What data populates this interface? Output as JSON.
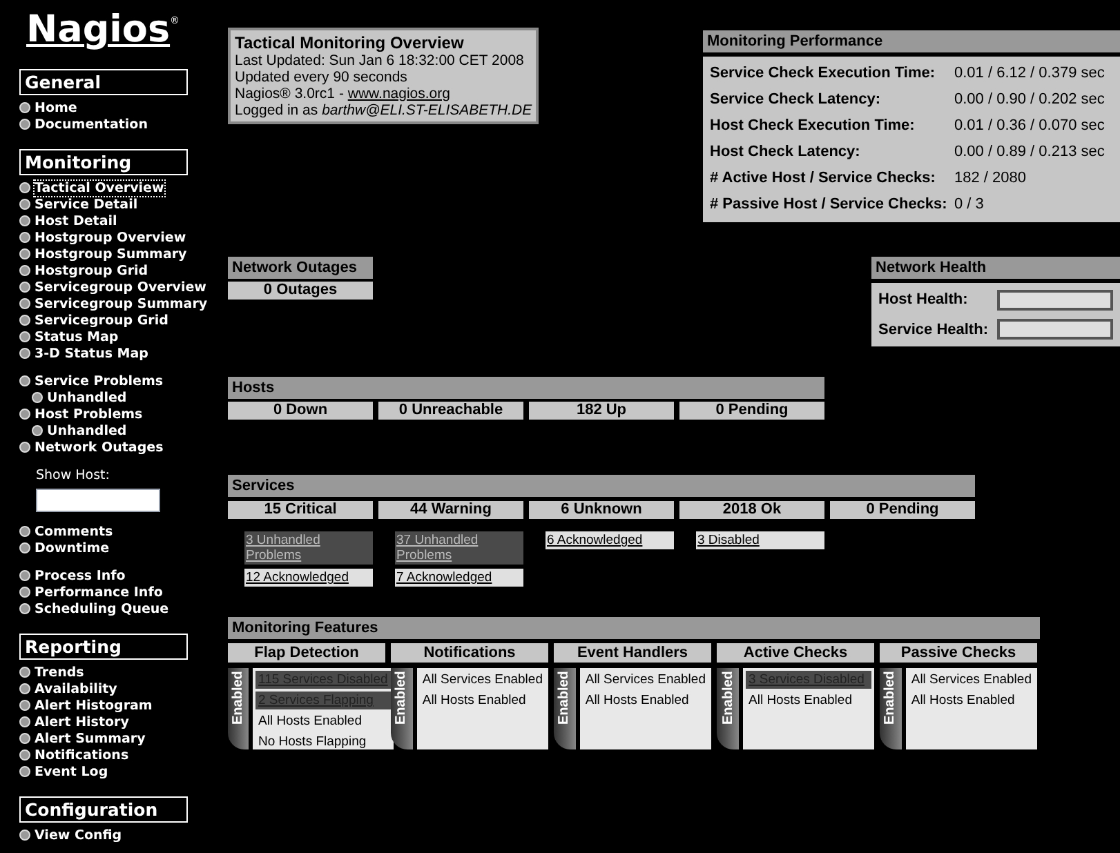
{
  "logo": {
    "text": "Nagios",
    "mark": "®"
  },
  "sidebar": [
    {
      "title": "General",
      "blocks": [
        {
          "kind": "links",
          "items": [
            {
              "label": "Home",
              "focused": false
            },
            {
              "label": "Documentation",
              "focused": false
            }
          ]
        }
      ]
    },
    {
      "title": "Monitoring",
      "blocks": [
        {
          "kind": "links",
          "items": [
            {
              "label": "Tactical Overview",
              "focused": true
            },
            {
              "label": "Service Detail",
              "focused": false
            },
            {
              "label": "Host Detail",
              "focused": false
            },
            {
              "label": "Hostgroup Overview",
              "focused": false
            },
            {
              "label": "Hostgroup Summary",
              "focused": false
            },
            {
              "label": "Hostgroup Grid",
              "focused": false
            },
            {
              "label": "Servicegroup Overview",
              "focused": false
            },
            {
              "label": "Servicegroup Summary",
              "focused": false
            },
            {
              "label": "Servicegroup Grid",
              "focused": false
            },
            {
              "label": "Status Map",
              "focused": false
            },
            {
              "label": "3-D Status Map",
              "focused": false
            }
          ]
        },
        {
          "kind": "links",
          "items": [
            {
              "label": "Service Problems",
              "focused": false,
              "children": [
                {
                  "label": "Unhandled",
                  "focused": false
                }
              ]
            },
            {
              "label": "Host Problems",
              "focused": false,
              "children": [
                {
                  "label": "Unhandled",
                  "focused": false
                }
              ]
            },
            {
              "label": "Network Outages",
              "focused": false
            }
          ]
        },
        {
          "kind": "field",
          "label": "Show Host:"
        },
        {
          "kind": "links",
          "items": [
            {
              "label": "Comments",
              "focused": false
            },
            {
              "label": "Downtime",
              "focused": false
            }
          ]
        },
        {
          "kind": "links",
          "items": [
            {
              "label": "Process Info",
              "focused": false
            },
            {
              "label": "Performance Info",
              "focused": false
            },
            {
              "label": "Scheduling Queue",
              "focused": false
            }
          ]
        }
      ]
    },
    {
      "title": "Reporting",
      "blocks": [
        {
          "kind": "links",
          "items": [
            {
              "label": "Trends",
              "focused": false
            },
            {
              "label": "Availability",
              "focused": false
            },
            {
              "label": "Alert Histogram",
              "focused": false
            },
            {
              "label": "Alert History",
              "focused": false
            },
            {
              "label": "Alert Summary",
              "focused": false
            },
            {
              "label": "Notifications",
              "focused": false
            },
            {
              "label": "Event Log",
              "focused": false
            }
          ]
        }
      ]
    },
    {
      "title": "Configuration",
      "blocks": [
        {
          "kind": "links",
          "items": [
            {
              "label": "View Config",
              "focused": false
            }
          ]
        }
      ]
    }
  ],
  "overview": {
    "title": "Tactical Monitoring Overview",
    "lines": [
      "Last Updated: Sun Jan 6 18:32:00 CET 2008",
      "Updated every 90 seconds"
    ],
    "version": {
      "text": "Nagios® 3.0rc1 - ",
      "link": "www.nagios.org"
    },
    "login": "Logged in as *barthw@ELI.ST-ELISABETH.DE*"
  },
  "performance": {
    "title": "Monitoring Performance",
    "rows": [
      {
        "label": "Service Check Execution Time:",
        "value": "0.01 / 6.12 / 0.379 sec"
      },
      {
        "label": "Service Check Latency:",
        "value": "0.00 / 0.90 / 0.202 sec"
      },
      {
        "label": "Host Check Execution Time:",
        "value": "0.01 / 0.36 / 0.070 sec"
      },
      {
        "label": "Host Check Latency:",
        "value": "0.00 / 0.89 / 0.213 sec"
      },
      {
        "label": "# Active Host / Service Checks:",
        "value": "182 / 2080"
      },
      {
        "label": "# Passive Host / Service Checks:",
        "value": "0 / 3"
      }
    ]
  },
  "network_outages": {
    "title": "Network Outages",
    "value": "0 Outages"
  },
  "network_health": {
    "title": "Network Health",
    "bars": [
      {
        "label": "Host Health:",
        "level": 1
      },
      {
        "label": "Service Health:",
        "level": 1
      }
    ]
  },
  "hosts": {
    "title": "Hosts",
    "cells": [
      {
        "label": "0 Down"
      },
      {
        "label": "0 Unreachable"
      },
      {
        "label": "182 Up"
      },
      {
        "label": "0 Pending"
      }
    ]
  },
  "services": {
    "title": "Services",
    "cells": [
      {
        "label": "15 Critical",
        "links": [
          {
            "text": "3 Unhandled Problems",
            "highlighted": true
          },
          {
            "text": "12 Acknowledged",
            "highlighted": false
          }
        ]
      },
      {
        "label": "44 Warning",
        "links": [
          {
            "text": "37 Unhandled Problems",
            "highlighted": true
          },
          {
            "text": "7 Acknowledged",
            "highlighted": false
          }
        ]
      },
      {
        "label": "6 Unknown",
        "links": [
          {
            "text": "6 Acknowledged",
            "highlighted": false
          }
        ]
      },
      {
        "label": "2018 Ok",
        "links": [
          {
            "text": "3 Disabled",
            "highlighted": false
          }
        ]
      },
      {
        "label": "0 Pending"
      }
    ]
  },
  "features": {
    "title": "Monitoring Features",
    "columns": [
      {
        "title": "Flap Detection",
        "state": "Enabled",
        "items": [
          {
            "text": "115 Services Disabled",
            "highlighted": true
          },
          {
            "text": "2 Services Flapping",
            "highlighted": true
          },
          {
            "text": "All Hosts Enabled",
            "highlighted": false
          },
          {
            "text": "No Hosts Flapping",
            "highlighted": false
          }
        ]
      },
      {
        "title": "Notifications",
        "state": "Enabled",
        "items": [
          {
            "text": "All Services Enabled",
            "highlighted": false
          },
          {
            "text": "All Hosts Enabled",
            "highlighted": false
          }
        ]
      },
      {
        "title": "Event Handlers",
        "state": "Enabled",
        "items": [
          {
            "text": "All Services Enabled",
            "highlighted": false
          },
          {
            "text": "All Hosts Enabled",
            "highlighted": false
          }
        ]
      },
      {
        "title": "Active Checks",
        "state": "Enabled",
        "items": [
          {
            "text": "3 Services Disabled",
            "highlighted": true
          },
          {
            "text": "All Hosts Enabled",
            "highlighted": false
          }
        ]
      },
      {
        "title": "Passive Checks",
        "state": "Enabled",
        "items": [
          {
            "text": "All Services Enabled",
            "highlighted": false
          },
          {
            "text": "All Hosts Enabled",
            "highlighted": false
          }
        ]
      }
    ]
  }
}
